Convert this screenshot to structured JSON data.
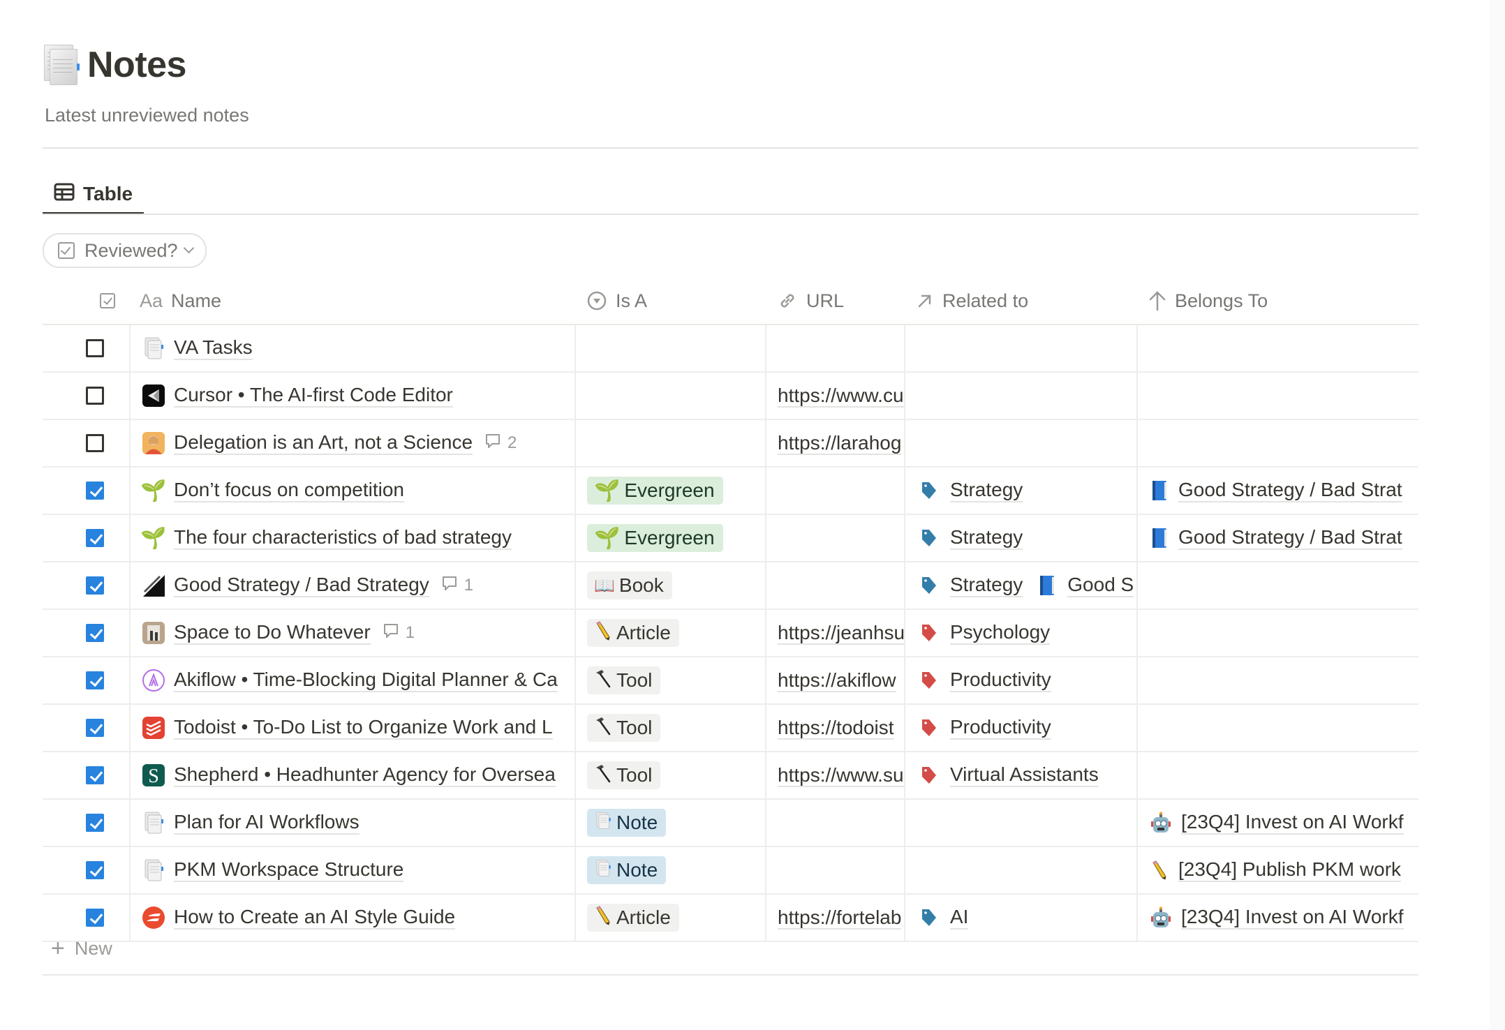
{
  "page": {
    "icon": "document-icon",
    "title": "Notes",
    "description": "Latest unreviewed notes"
  },
  "views": [
    {
      "label": "Table",
      "icon": "table-icon",
      "active": true
    }
  ],
  "filter": {
    "label": "Reviewed?",
    "icon": "checkbox-icon"
  },
  "columns": [
    {
      "key": "reviewed",
      "label": "",
      "icon": "checkbox-icon"
    },
    {
      "key": "name",
      "label": "Name",
      "icon_text": "Aa"
    },
    {
      "key": "is_a",
      "label": "Is A",
      "icon": "select-icon"
    },
    {
      "key": "url",
      "label": "URL",
      "icon": "link-icon"
    },
    {
      "key": "related_to",
      "label": "Related to",
      "icon": "arrow-up-right-icon"
    },
    {
      "key": "belongs_to",
      "label": "Belongs To",
      "icon": "arrow-up-icon"
    }
  ],
  "rows": [
    {
      "reviewed": false,
      "icon": "document-icon",
      "name": "VA Tasks",
      "comments": null,
      "is_a": null,
      "url": "",
      "related": [],
      "belongs": null
    },
    {
      "reviewed": false,
      "icon": "cursor-app-icon",
      "name": "Cursor • The AI-first Code Editor",
      "comments": null,
      "is_a": null,
      "url": "https://www.cu",
      "related": [],
      "belongs": null
    },
    {
      "reviewed": false,
      "icon": "person-avatar-icon",
      "name": "Delegation is an Art, not a Science",
      "comments": "2",
      "is_a": null,
      "url": "https://larahog",
      "related": [],
      "belongs": null
    },
    {
      "reviewed": true,
      "icon": "seedling-icon",
      "name": "Don’t focus on competition",
      "comments": null,
      "is_a": {
        "label": "Evergreen",
        "emoji": "seedling-icon",
        "color": "green"
      },
      "url": "",
      "related": [
        {
          "label": "Strategy",
          "icon": "tag-blue-icon"
        }
      ],
      "belongs": {
        "label": "Good Strategy / Bad Strat",
        "icon": "blue-book-icon"
      }
    },
    {
      "reviewed": true,
      "icon": "seedling-icon",
      "name": "The four characteristics of bad strategy",
      "comments": null,
      "is_a": {
        "label": "Evergreen",
        "emoji": "seedling-icon",
        "color": "green"
      },
      "url": "",
      "related": [
        {
          "label": "Strategy",
          "icon": "tag-blue-icon"
        }
      ],
      "belongs": {
        "label": "Good Strategy / Bad Strat",
        "icon": "blue-book-icon"
      }
    },
    {
      "reviewed": true,
      "icon": "book-cover-icon",
      "name": "Good Strategy / Bad Strategy",
      "comments": "1",
      "is_a": {
        "label": "Book",
        "emoji": "open-book-icon",
        "color": "gray"
      },
      "url": "",
      "related": [
        {
          "label": "Strategy",
          "icon": "tag-blue-icon"
        },
        {
          "label": "Good S",
          "icon": "blue-book-icon"
        }
      ],
      "belongs": null
    },
    {
      "reviewed": true,
      "icon": "photo-thumbnail-icon",
      "name": "Space to Do Whatever",
      "comments": "1",
      "is_a": {
        "label": "Article",
        "emoji": "pencil-icon",
        "color": "gray"
      },
      "url": "https://jeanhsu",
      "related": [
        {
          "label": "Psychology",
          "icon": "tag-red-icon"
        }
      ],
      "belongs": null
    },
    {
      "reviewed": true,
      "icon": "akiflow-icon",
      "name": "Akiflow • Time-Blocking Digital Planner & Ca",
      "comments": null,
      "is_a": {
        "label": "Tool",
        "emoji": "hammer-icon",
        "color": "gray"
      },
      "url": "https://akiflow",
      "related": [
        {
          "label": "Productivity",
          "icon": "tag-red-icon"
        }
      ],
      "belongs": null
    },
    {
      "reviewed": true,
      "icon": "todoist-icon",
      "name": "Todoist • To-Do List to Organize Work and L",
      "comments": null,
      "is_a": {
        "label": "Tool",
        "emoji": "hammer-icon",
        "color": "gray"
      },
      "url": "https://todoist",
      "related": [
        {
          "label": "Productivity",
          "icon": "tag-red-icon"
        }
      ],
      "belongs": null
    },
    {
      "reviewed": true,
      "icon": "shepherd-icon",
      "name": "Shepherd • Headhunter Agency for Oversea",
      "comments": null,
      "is_a": {
        "label": "Tool",
        "emoji": "hammer-icon",
        "color": "gray"
      },
      "url": "https://www.su",
      "related": [
        {
          "label": "Virtual Assistants",
          "icon": "tag-red-icon"
        }
      ],
      "belongs": null
    },
    {
      "reviewed": true,
      "icon": "document-icon",
      "name": "Plan for AI Workflows",
      "comments": null,
      "is_a": {
        "label": "Note",
        "emoji": "document-icon",
        "color": "blue"
      },
      "url": "",
      "related": [],
      "belongs": {
        "label": "[23Q4] Invest on AI Workf",
        "icon": "robot-icon"
      }
    },
    {
      "reviewed": true,
      "icon": "document-icon",
      "name": "PKM Workspace Structure",
      "comments": null,
      "is_a": {
        "label": "Note",
        "emoji": "document-icon",
        "color": "blue"
      },
      "url": "",
      "related": [],
      "belongs": {
        "label": "[23Q4] Publish PKM work",
        "icon": "pencil-icon"
      }
    },
    {
      "reviewed": true,
      "icon": "fortelabs-icon",
      "name": "How to Create an AI Style Guide",
      "comments": null,
      "is_a": {
        "label": "Article",
        "emoji": "pencil-icon",
        "color": "gray"
      },
      "url": "https://fortelab",
      "related": [
        {
          "label": "AI",
          "icon": "tag-blue-icon"
        }
      ],
      "belongs": {
        "label": "[23Q4] Invest on AI Workf",
        "icon": "robot-icon"
      }
    }
  ],
  "new_row": {
    "label": "New",
    "icon": "plus-icon"
  },
  "colors": {
    "text": "#37352f",
    "muted": "#787774",
    "checkbox_checked": "#2783de",
    "tag_green_bg": "#dbeddb",
    "tag_gray_bg": "#f1f1ef",
    "tag_blue_bg": "#d3e5ef",
    "tag_blue_icon": "#337ea9",
    "tag_red_icon": "#d44c47"
  }
}
